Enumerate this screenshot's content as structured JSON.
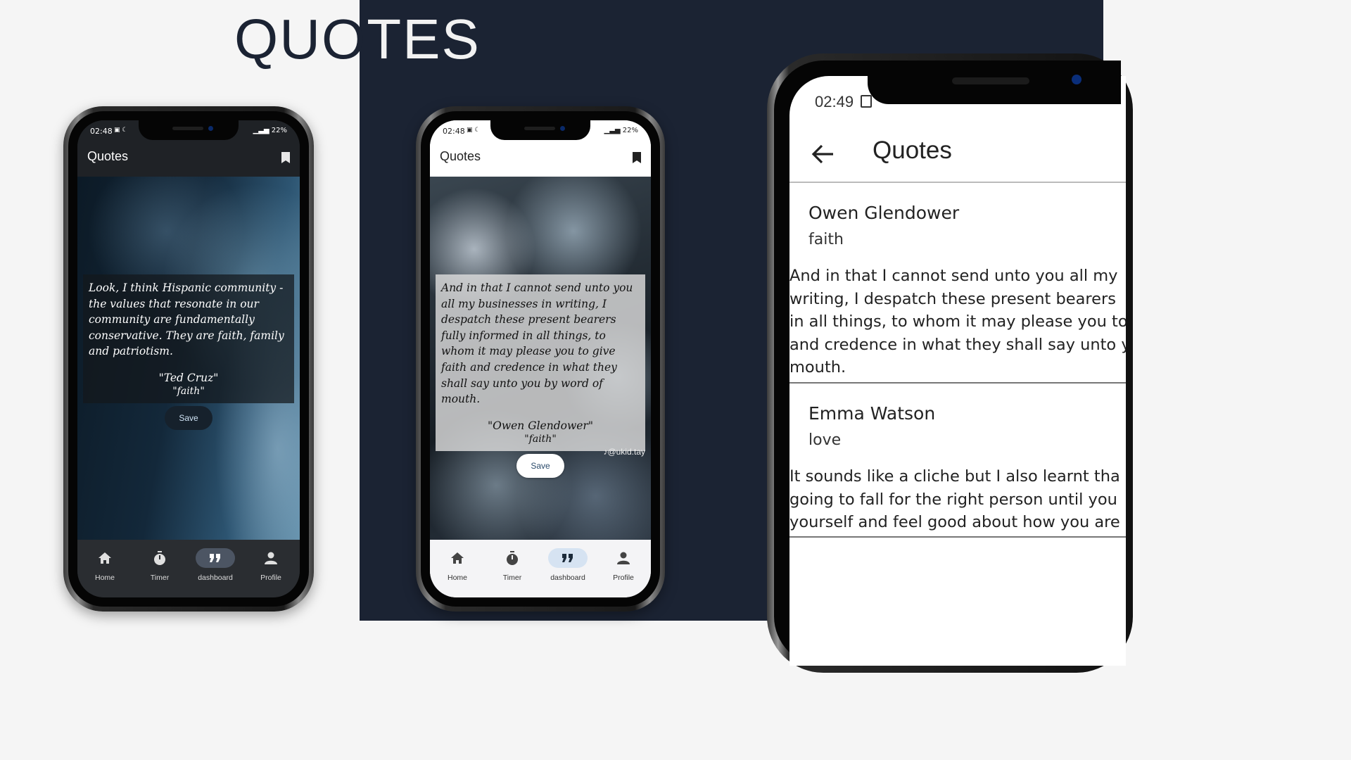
{
  "banner": {
    "title_dark": "QUO",
    "title_light": "TES"
  },
  "phones": [
    {
      "status": {
        "time": "02:48",
        "battery": "22%"
      },
      "app_title": "Quotes",
      "quote": {
        "text": "Look, I think Hispanic community - the values that resonate in our community are fundamentally conservative. They are faith, family and patriotism.",
        "author": "\"Ted Cruz\"",
        "category": "\"faith\""
      },
      "save_label": "Save",
      "nav": [
        {
          "label": "Home",
          "icon": "home-icon"
        },
        {
          "label": "Timer",
          "icon": "timer-icon"
        },
        {
          "label": "dashboard",
          "icon": "quote-icon",
          "active": true
        },
        {
          "label": "Profile",
          "icon": "person-icon"
        }
      ],
      "theme": "dark"
    },
    {
      "status": {
        "time": "02:48",
        "battery": "22%"
      },
      "app_title": "Quotes",
      "quote": {
        "text": "And in that I cannot send unto you all my businesses in writing, I despatch these present bearers fully informed in all things, to whom it may please you to give faith and credence in what they shall say unto you by word of mouth.",
        "author": "\"Owen Glendower\"",
        "category": "\"faith\""
      },
      "watermark": "@ukid.tay",
      "save_label": "Save",
      "nav": [
        {
          "label": "Home",
          "icon": "home-icon"
        },
        {
          "label": "Timer",
          "icon": "timer-icon"
        },
        {
          "label": "dashboard",
          "icon": "quote-icon",
          "active": true
        },
        {
          "label": "Profile",
          "icon": "person-icon"
        }
      ],
      "theme": "light"
    }
  ],
  "zoom_phone": {
    "status_time": "02:49",
    "title": "Quotes",
    "items": [
      {
        "author": "Owen Glendower",
        "category": "faith",
        "lines": [
          "And in that I cannot send unto you all my",
          "writing, I despatch these present bearers",
          "in all things, to whom it may please you to",
          "and credence in what they shall say unto y",
          "mouth."
        ]
      },
      {
        "author": "Emma Watson",
        "category": "love",
        "lines": [
          "It sounds like a cliche but I also learnt tha",
          "going to fall for the right person until you",
          "yourself and feel good about how you are"
        ]
      }
    ]
  }
}
